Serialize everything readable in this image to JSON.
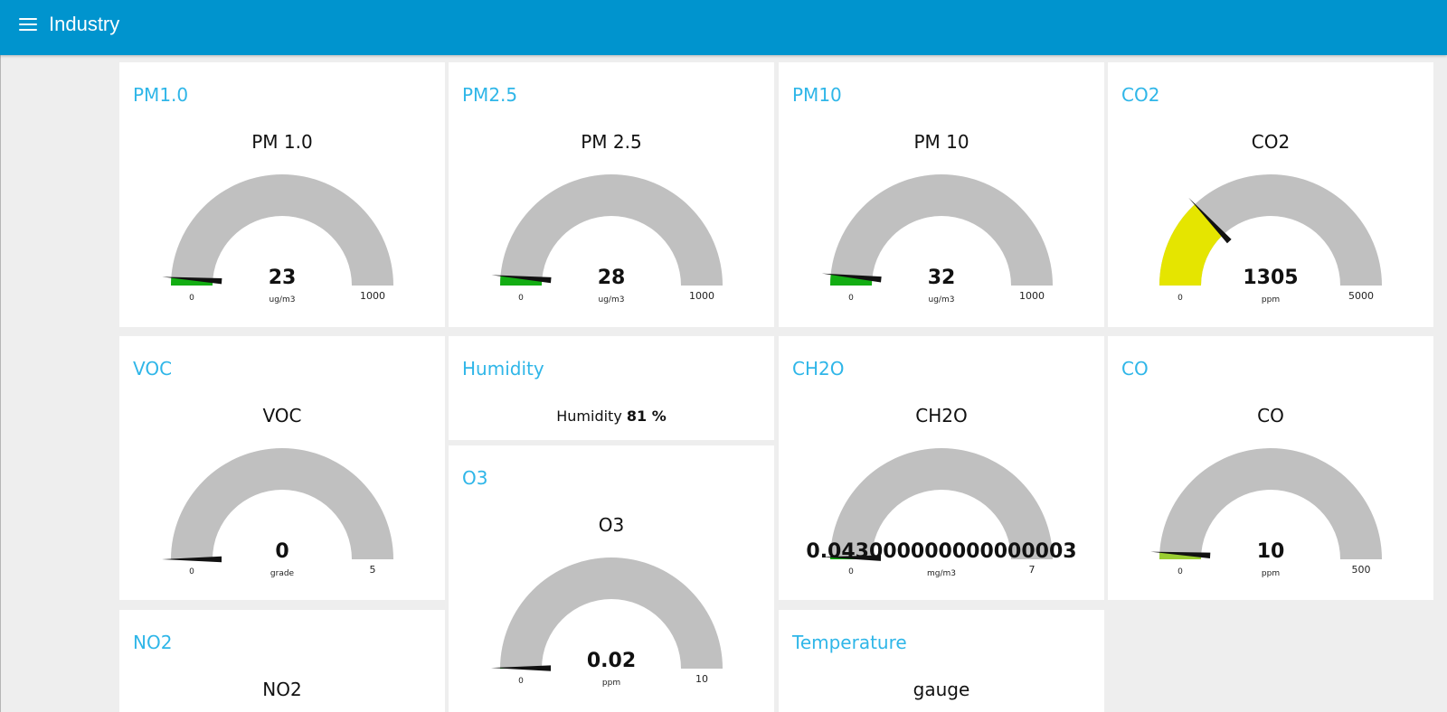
{
  "app": {
    "title": "Industry"
  },
  "colors": {
    "toolbar": "#0094ce",
    "title": "#2fb6e8",
    "track": "#c0c0c0",
    "low": "#13ad13",
    "mid": "#e5e500",
    "low_mid": "#9acd32",
    "needle": "#111111"
  },
  "cards": {
    "pm1": {
      "title": "PM1.0",
      "label": "PM 1.0",
      "value": "23",
      "units": "ug/m3",
      "min": "0",
      "max": "1000",
      "num": 23,
      "lo": 0,
      "hi": 1000,
      "color": "#13ad13"
    },
    "pm25": {
      "title": "PM2.5",
      "label": "PM 2.5",
      "value": "28",
      "units": "ug/m3",
      "min": "0",
      "max": "1000",
      "num": 28,
      "lo": 0,
      "hi": 1000,
      "color": "#13ad13"
    },
    "pm10": {
      "title": "PM10",
      "label": "PM 10",
      "value": "32",
      "units": "ug/m3",
      "min": "0",
      "max": "1000",
      "num": 32,
      "lo": 0,
      "hi": 1000,
      "color": "#13ad13"
    },
    "co2": {
      "title": "CO2",
      "label": "CO2",
      "value": "1305",
      "units": "ppm",
      "min": "0",
      "max": "5000",
      "num": 1305,
      "lo": 0,
      "hi": 5000,
      "color": "#e5e500"
    },
    "voc": {
      "title": "VOC",
      "label": "VOC",
      "value": "0",
      "units": "grade",
      "min": "0",
      "max": "5",
      "num": 0,
      "lo": 0,
      "hi": 5,
      "color": "#13ad13"
    },
    "humidity": {
      "title": "Humidity",
      "label": "Humidity",
      "value": "81 %"
    },
    "ch2o": {
      "title": "CH2O",
      "label": "CH2O",
      "value": "0.043000000000000003",
      "units": "mg/m3",
      "min": "0",
      "max": "7",
      "num": 0.043,
      "lo": 0,
      "hi": 7,
      "color": "#13ad13"
    },
    "co": {
      "title": "CO",
      "label": "CO",
      "value": "10",
      "units": "ppm",
      "min": "0",
      "max": "500",
      "num": 10,
      "lo": 0,
      "hi": 500,
      "color": "#9acd32"
    },
    "o3": {
      "title": "O3",
      "label": "O3",
      "value": "0.02",
      "units": "ppm",
      "min": "0",
      "max": "10",
      "num": 0.02,
      "lo": 0,
      "hi": 10,
      "color": "#13ad13"
    },
    "no2": {
      "title": "NO2",
      "label": "NO2"
    },
    "temperature": {
      "title": "Temperature",
      "label": "gauge"
    }
  }
}
